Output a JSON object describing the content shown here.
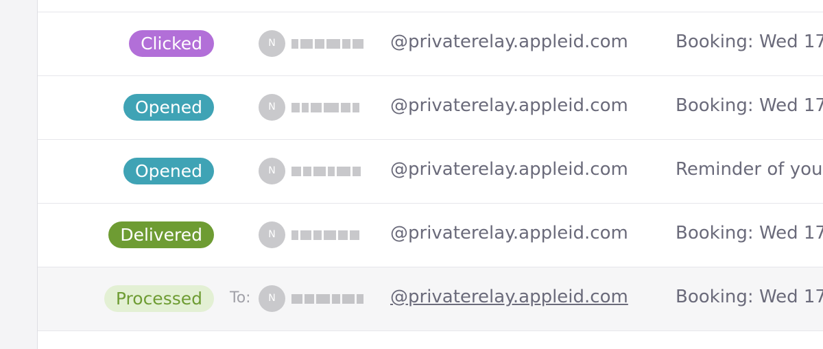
{
  "list": {
    "rows": [
      {
        "status": "Clicked",
        "avatar": "N",
        "email": "@privaterelay.appleid.com",
        "subject": "Booking: Wed 17"
      },
      {
        "status": "Opened",
        "avatar": "N",
        "email": "@privaterelay.appleid.com",
        "subject": "Booking: Wed 17"
      },
      {
        "status": "Opened",
        "avatar": "N",
        "email": "@privaterelay.appleid.com",
        "subject": "Reminder of you"
      },
      {
        "status": "Delivered",
        "avatar": "N",
        "email": "@privaterelay.appleid.com",
        "subject": "Booking: Wed 17"
      },
      {
        "status": "Processed",
        "to_label": "To:",
        "avatar": "N",
        "email": "@privaterelay.appleid.com",
        "subject": "Booking: Wed 17"
      }
    ]
  },
  "colors": {
    "clicked": "#b26fd8",
    "opened": "#3fa3b5",
    "delivered": "#6e9c33",
    "processed_bg": "#e3f0d4",
    "processed_text": "#6e9c33"
  }
}
